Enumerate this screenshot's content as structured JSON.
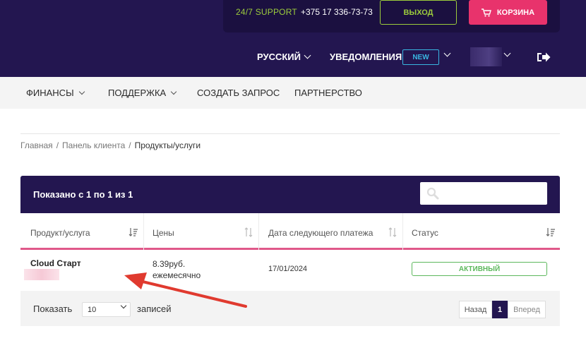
{
  "header": {
    "support": "24/7 SUPPORT",
    "phone": "+375 17 336-73-73",
    "exit_label": "ВЫХОД",
    "cart_label": "КОРЗИНА",
    "language": "РУССКИЙ",
    "notifications": "УВЕДОМЛЕНИЯ",
    "new_badge": "NEW"
  },
  "nav": {
    "items": [
      {
        "label": "ФИНАНСЫ",
        "dropdown": true
      },
      {
        "label": "ПОДДЕРЖКА",
        "dropdown": true
      },
      {
        "label": "СОЗДАТЬ ЗАПРОС",
        "dropdown": false
      },
      {
        "label": "ПАРТНЕРСТВО",
        "dropdown": false
      }
    ]
  },
  "breadcrumb": {
    "items": [
      "Главная",
      "Панель клиента",
      "Продукты/услуги"
    ],
    "separator": "/"
  },
  "table": {
    "summary": "Показано с 1 по 1 из 1",
    "search_placeholder": "",
    "columns": [
      "Продукт/услуга",
      "Цены",
      "Дата следующего платежа",
      "Статус"
    ],
    "rows": [
      {
        "product": "Cloud Старт",
        "price_line1": "8.39руб.",
        "price_line2": "ежемесячно",
        "next_payment": "17/01/2024",
        "status": "АКТИВНЫЙ"
      }
    ],
    "footer": {
      "show_label": "Показать",
      "per_page": "10",
      "records_label": "записей",
      "prev": "Назад",
      "page": "1",
      "next": "Вперед"
    }
  },
  "colors": {
    "brand_dark": "#231650",
    "accent_pink": "#e8336c",
    "accent_green": "#9ccc3c",
    "status_green": "#5cb85c",
    "badge_blue": "#39b5e0",
    "annotation_red": "#e03a2f"
  },
  "icons": [
    "cart-icon",
    "chevron-down-icon",
    "logout-icon",
    "search-icon",
    "sort-icon"
  ]
}
